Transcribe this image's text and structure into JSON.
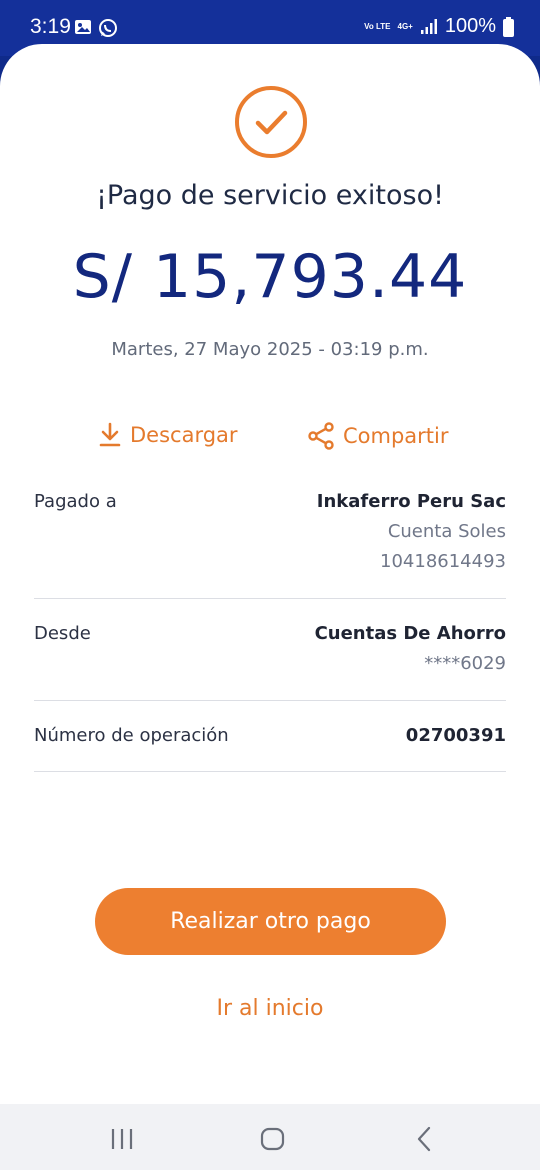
{
  "status_bar": {
    "time": "3:19",
    "network_top": "4G+",
    "network_left": "Vo LTE",
    "battery": "100%"
  },
  "receipt": {
    "title": "¡Pago de servicio exitoso!",
    "amount": "S/ 15,793.44",
    "datetime": "Martes, 27 Mayo 2025 - 03:19 p.m.",
    "download_label": "Descargar",
    "share_label": "Compartir"
  },
  "details": {
    "paid_to_label": "Pagado a",
    "paid_to_name": "Inkaferro Peru Sac",
    "paid_to_account_type": "Cuenta Soles",
    "paid_to_account_number": "10418614493",
    "from_label": "Desde",
    "from_account": "Cuentas De Ahorro",
    "from_masked": "****6029",
    "operation_label": "Número de operación",
    "operation_number": "02700391"
  },
  "actions": {
    "primary_button": "Realizar otro pago",
    "secondary_link": "Ir al inicio"
  },
  "icons": {
    "success": "check-circle-icon",
    "download": "download-icon",
    "share": "share-icon"
  },
  "colors": {
    "accent": "#ed7f30",
    "brand": "#13287e",
    "status_bar": "#14309a"
  }
}
